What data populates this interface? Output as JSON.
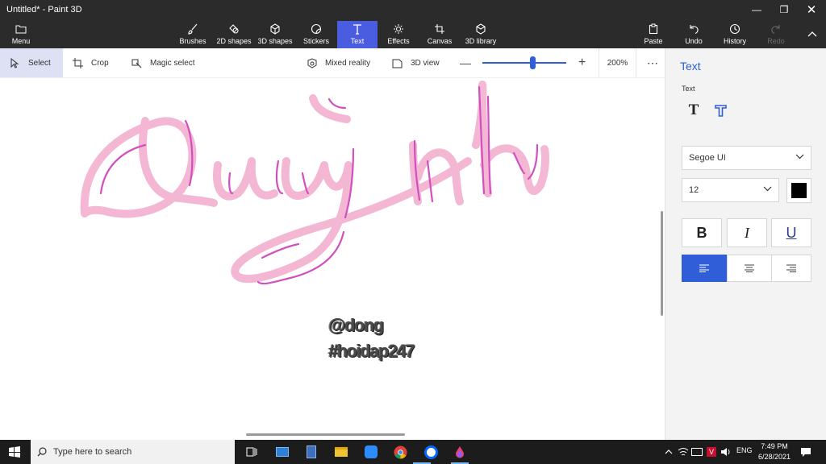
{
  "window": {
    "title": "Untitled* - Paint 3D"
  },
  "ribbon": {
    "menu_label": "Menu",
    "tools": [
      {
        "label": "Brushes",
        "icon": "brush-icon"
      },
      {
        "label": "2D shapes",
        "icon": "2d-shapes-icon"
      },
      {
        "label": "3D shapes",
        "icon": "3d-shapes-icon"
      },
      {
        "label": "Stickers",
        "icon": "stickers-icon"
      },
      {
        "label": "Text",
        "icon": "text-icon",
        "active": true
      },
      {
        "label": "Effects",
        "icon": "effects-icon"
      },
      {
        "label": "Canvas",
        "icon": "canvas-icon"
      },
      {
        "label": "3D library",
        "icon": "3d-library-icon"
      }
    ],
    "right_tools": [
      {
        "label": "Paste",
        "icon": "paste-icon"
      },
      {
        "label": "Undo",
        "icon": "undo-icon"
      },
      {
        "label": "History",
        "icon": "history-icon"
      },
      {
        "label": "Redo",
        "icon": "redo-icon",
        "disabled": true
      }
    ]
  },
  "commandbar": {
    "select": "Select",
    "crop": "Crop",
    "magic_select": "Magic select",
    "mixed_reality": "Mixed reality",
    "view_3d": "3D view",
    "zoom": "200%",
    "zoom_level": 0.6
  },
  "canvas": {
    "watermark_line1": "@dong",
    "watermark_line2": "#hoidap247",
    "ink_color": "#f3b4d2",
    "stroke_color": "#d24fbf"
  },
  "sidepanel": {
    "title": "Text",
    "section_label": "Text",
    "font": "Segoe UI",
    "size": "12",
    "color": "#000000",
    "bold": "B",
    "italic": "I",
    "underline": "U"
  },
  "taskbar": {
    "search_placeholder": "Type here to search",
    "language": "ENG",
    "time": "7:49 PM",
    "date": "6/28/2021"
  },
  "colors": {
    "accent": "#4a5cdf",
    "ribbon": "#2b2b2b"
  }
}
